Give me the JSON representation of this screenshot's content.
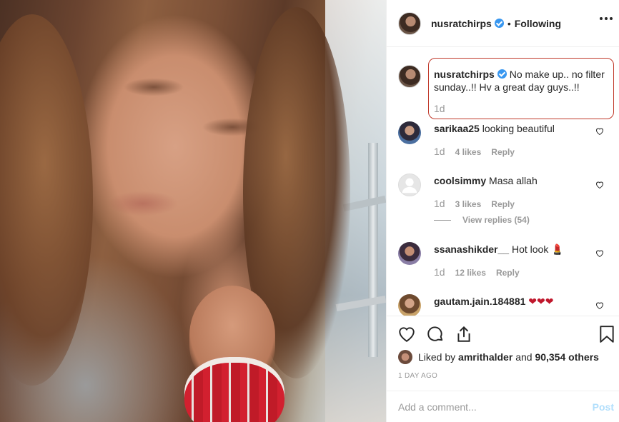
{
  "header": {
    "username": "nusratchirps",
    "separator": "•",
    "follow_status": "Following"
  },
  "caption": {
    "username": "nusratchirps",
    "text": "No make up.. no filter sunday..!! Hv a great day guys..!!",
    "age": "1d"
  },
  "comments": [
    {
      "username": "sarikaa25",
      "text": "looking beautiful",
      "age": "1d",
      "likes": "4 likes",
      "reply": "Reply"
    },
    {
      "username": "coolsimmy",
      "text": "Masa allah",
      "age": "1d",
      "likes": "3 likes",
      "reply": "Reply",
      "view_replies": "View replies (54)"
    },
    {
      "username": "ssanashikder__",
      "text": "Hot look 💄",
      "age": "1d",
      "likes": "12 likes",
      "reply": "Reply"
    },
    {
      "username": "gautam.jain.184881",
      "text": "❤❤❤"
    }
  ],
  "likes": {
    "prefix": "Liked by",
    "user": "amrithalder",
    "and": "and",
    "count": "90,354 others"
  },
  "post_age": "1 DAY AGO",
  "add_comment": {
    "placeholder": "Add a comment...",
    "post_label": "Post"
  },
  "icons": {
    "like": "heart-icon",
    "comment": "comment-icon",
    "share": "share-icon",
    "save": "bookmark-icon",
    "more": "more-options-icon",
    "verified": "verified-badge-icon"
  },
  "colors": {
    "verified": "#3897f0",
    "highlight_border": "#c0392b",
    "post_disabled": "#b2dffc",
    "muted": "#999999",
    "heart_red": "#c0172c"
  }
}
